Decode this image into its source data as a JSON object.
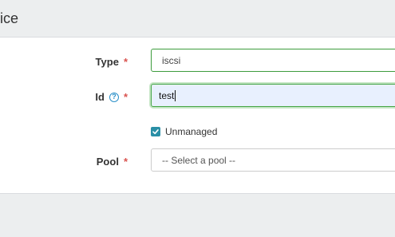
{
  "header": {
    "title": "ice"
  },
  "form": {
    "type": {
      "label": "Type",
      "required": "*",
      "value": "iscsi"
    },
    "id": {
      "label": "Id",
      "required": "*",
      "help_icon": "question-circle-icon",
      "value": "test"
    },
    "unmanaged": {
      "label": "Unmanaged",
      "checked": true
    },
    "pool": {
      "label": "Pool",
      "required": "*",
      "selected": "-- Select a pool --"
    }
  },
  "colors": {
    "header_bg": "#eceeef",
    "valid_border": "#3c9b3c",
    "required_asterisk": "#d9534f",
    "checkbox_fill": "#2a8fa6",
    "help_icon": "#2b90c9"
  }
}
